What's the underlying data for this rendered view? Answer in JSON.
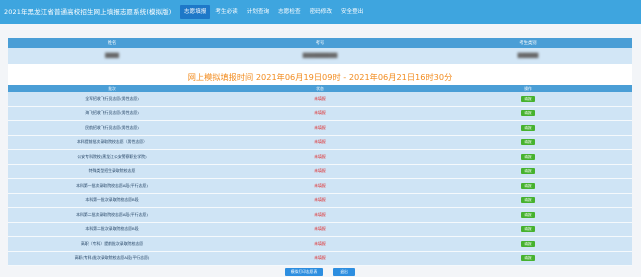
{
  "header": {
    "title": "2021年黑龙江省普通高校招生网上填报志愿系统(模拟版)",
    "nav": [
      "志愿填报",
      "考生必读",
      "计划查询",
      "志愿检查",
      "密码修改",
      "安全登出"
    ]
  },
  "info": {
    "columns": [
      "姓名",
      "考号",
      "考生类别"
    ],
    "values": [
      "████",
      "██████████",
      "██████"
    ]
  },
  "period": "网上模拟填报时间 2021年06月19日09时 - 2021年06月21日16时30分",
  "volunteer_table": {
    "columns": [
      "批次",
      "状态",
      "操作"
    ],
    "rows": [
      {
        "name": "全军招收飞行员志愿(男性志愿)",
        "status": "未填报",
        "action": "填报"
      },
      {
        "name": "海飞招收飞行员志愿(男性志愿)",
        "status": "未填报",
        "action": "填报"
      },
      {
        "name": "民航招收飞行员志愿(男性志愿)",
        "status": "未填报",
        "action": "填报"
      },
      {
        "name": "本科提前批次录取院校志愿（男性志愿）",
        "status": "未填报",
        "action": "填报"
      },
      {
        "name": "公安专科院校(黑龙江公安警察职业学院)",
        "status": "未填报",
        "action": "填报"
      },
      {
        "name": "特殊类型招生录取院校志愿",
        "status": "未填报",
        "action": "填报"
      },
      {
        "name": "本科第一批次录取院校志愿A段(平行志愿)",
        "status": "未填报",
        "action": "填报"
      },
      {
        "name": "本科第一批次录取院校志愿B段",
        "status": "未填报",
        "action": "填报"
      },
      {
        "name": "本科第二批次录取院校志愿A段(平行志愿)",
        "status": "未填报",
        "action": "填报"
      },
      {
        "name": "本科第二批次录取院校志愿B段",
        "status": "未填报",
        "action": "填报"
      },
      {
        "name": "高职（专科）提前批次录取院校志愿",
        "status": "未填报",
        "action": "填报"
      },
      {
        "name": "高职(专科)批次录取院校志愿A段(平行志愿)",
        "status": "未填报",
        "action": "填报"
      }
    ]
  },
  "buttons": {
    "print": "模拟打印志愿表",
    "exit": "退出"
  }
}
